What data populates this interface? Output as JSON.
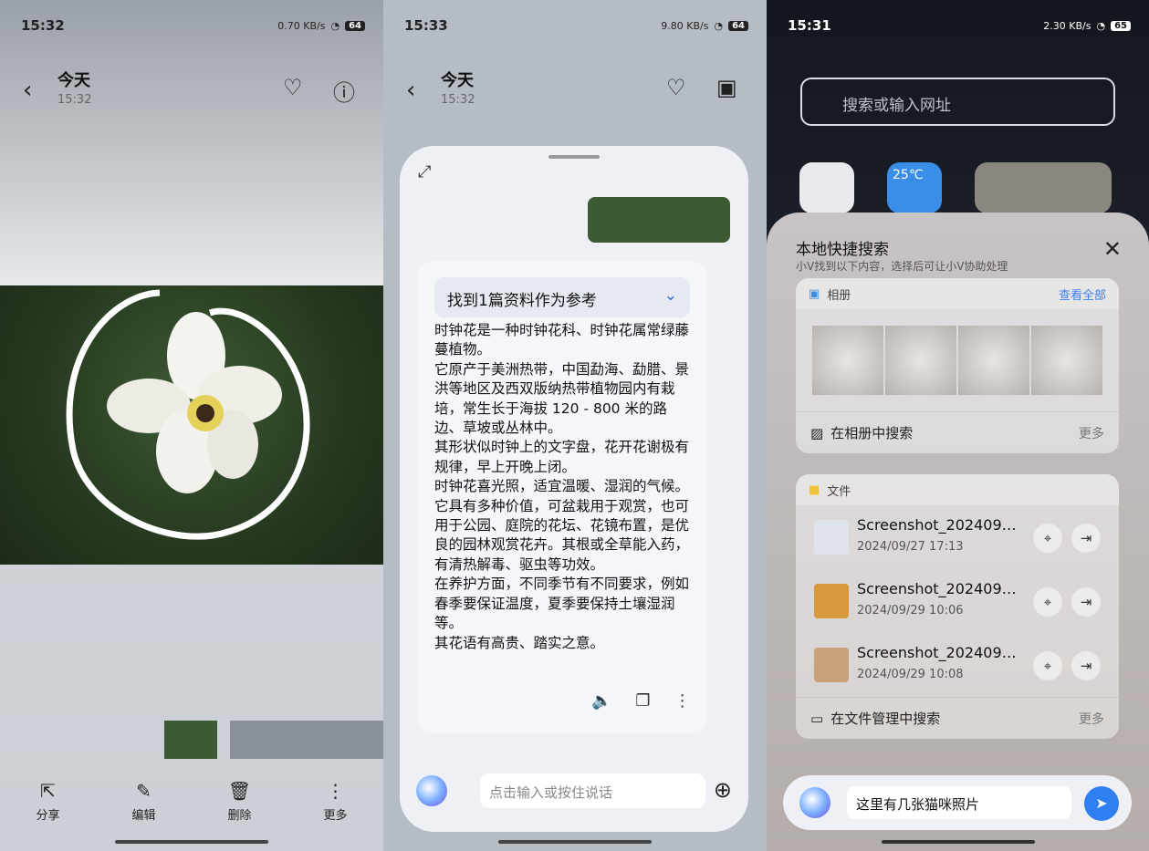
{
  "p1": {
    "time": "15:32",
    "net": "0.70 KB/s",
    "battery": "64",
    "title": "今天",
    "sub": "15:32",
    "toolbar": [
      {
        "icon": "share-icon",
        "label": "分享"
      },
      {
        "icon": "edit-icon",
        "label": "编辑"
      },
      {
        "icon": "delete-icon",
        "label": "删除"
      },
      {
        "icon": "more-icon",
        "label": "更多"
      }
    ]
  },
  "p2": {
    "time": "15:33",
    "net": "9.80 KB/s",
    "battery": "64",
    "title": "今天",
    "sub": "15:32",
    "ref": "找到1篇资料作为参考",
    "answer": "时钟花是一种时钟花科、时钟花属常绿藤蔓植物。\n它原产于美洲热带，中国勐海、勐腊、景洪等地区及西双版纳热带植物园内有栽培，常生长于海拔 120 - 800 米的路边、草坡或丛林中。\n其形状似时钟上的文字盘，花开花谢极有规律，早上开晚上闭。\n时钟花喜光照，适宜温暖、湿润的气候。\n它具有多种价值，可盆栽用于观赏，也可用于公园、庭院的花坛、花镜布置，是优良的园林观赏花卉。其根或全草能入药，有清热解毒、驱虫等功效。\n在养护方面，不同季节有不同要求，例如春季要保证温度，夏季要保持土壤湿润等。\n其花语有高贵、踏实之意。",
    "placeholder": "点击输入或按住说话"
  },
  "p3": {
    "time": "15:31",
    "net": "2.30 KB/s",
    "battery": "65",
    "search": "搜索或输入网址",
    "weather": "25℃",
    "title": "本地快捷搜索",
    "sub": "小V找到以下内容，选择后可让小V协助处理",
    "album": {
      "label": "相册",
      "all": "查看全部",
      "search": "在相册中搜索",
      "more": "更多"
    },
    "files": {
      "label": "文件",
      "search": "在文件管理中搜索",
      "more": "更多",
      "items": [
        {
          "name": "Screenshot_202409…",
          "date": "2024/09/27 17:13"
        },
        {
          "name": "Screenshot_202409…",
          "date": "2024/09/29 10:06"
        },
        {
          "name": "Screenshot_202409…",
          "date": "2024/09/29 10:08"
        }
      ]
    },
    "chat": "这里有几张猫咪照片"
  }
}
